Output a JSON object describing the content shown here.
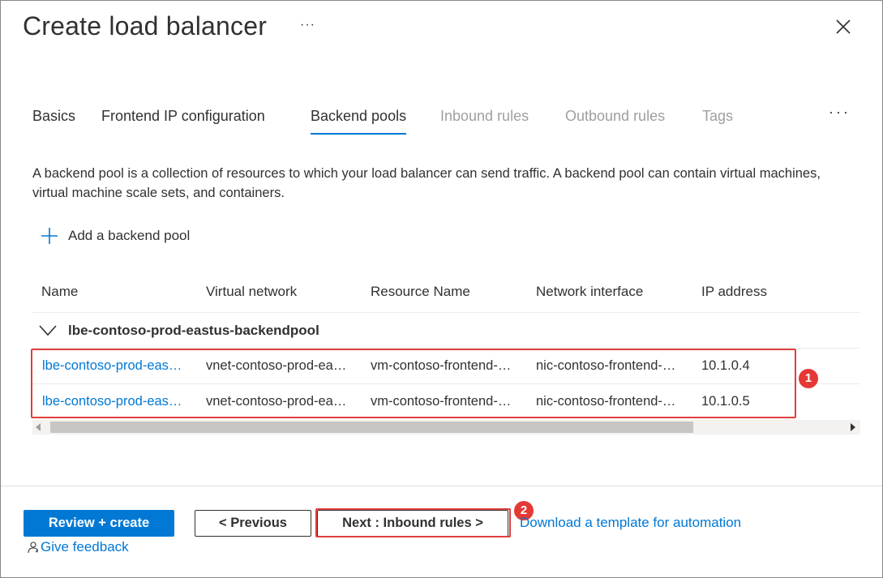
{
  "header": {
    "title": "Create load balancer",
    "more_label": "···"
  },
  "tabs": [
    {
      "label": "Basics",
      "state": "enabled"
    },
    {
      "label": "Frontend IP configuration",
      "state": "enabled"
    },
    {
      "label": "Backend pools",
      "state": "active"
    },
    {
      "label": "Inbound rules",
      "state": "disabled"
    },
    {
      "label": "Outbound rules",
      "state": "disabled"
    },
    {
      "label": "Tags",
      "state": "disabled"
    }
  ],
  "tabs_more_label": "···",
  "description": "A backend pool is a collection of resources to which your load balancer can send traffic. A backend pool can contain virtual machines, virtual machine scale sets, and containers.",
  "add_pool": {
    "label": "Add a backend pool",
    "icon": "plus-icon"
  },
  "table": {
    "columns": [
      "Name",
      "Virtual network",
      "Resource Name",
      "Network interface",
      "IP address"
    ],
    "group": {
      "label": "lbe-contoso-prod-eastus-backendpool",
      "expanded": true
    },
    "rows": [
      {
        "name": "lbe-contoso-prod-eas…",
        "vnet": "vnet-contoso-prod-ea…",
        "resource": "vm-contoso-frontend-…",
        "nic": "nic-contoso-frontend-…",
        "ip": "10.1.0.4"
      },
      {
        "name": "lbe-contoso-prod-eas…",
        "vnet": "vnet-contoso-prod-ea…",
        "resource": "vm-contoso-frontend-…",
        "nic": "nic-contoso-frontend-…",
        "ip": "10.1.0.5"
      }
    ]
  },
  "callouts": {
    "one": "1",
    "two": "2"
  },
  "footer": {
    "review_create": "Review + create",
    "previous": "< Previous",
    "next": "Next : Inbound rules >",
    "download": "Download a template for automation",
    "feedback": "Give feedback"
  },
  "colors": {
    "accent": "#0078d4",
    "highlight": "#e03e3e",
    "disabled_text": "#a19f9d"
  }
}
